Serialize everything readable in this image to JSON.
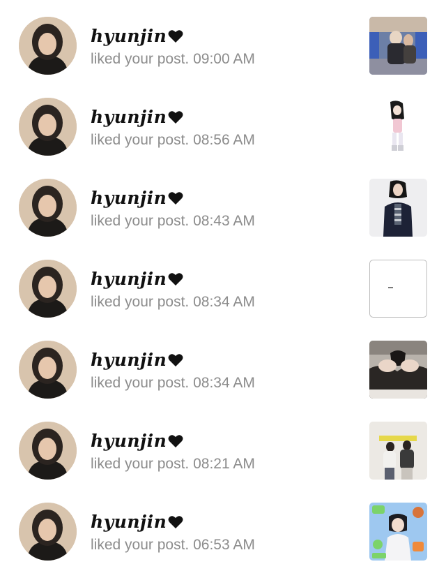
{
  "notifications": [
    {
      "username": "hyunjin",
      "action": "liked your post.",
      "time": "09:00 AM",
      "post_thumbnail": "stage-performance-photo"
    },
    {
      "username": "hyunjin",
      "action": "liked your post.",
      "time": "08:56 AM",
      "post_thumbnail": "anime-character-drawing"
    },
    {
      "username": "hyunjin",
      "action": "liked your post.",
      "time": "08:43 AM",
      "post_thumbnail": "person-in-blazer-photo"
    },
    {
      "username": "hyunjin",
      "action": "liked your post.",
      "time": "08:34 AM",
      "post_thumbnail": "blank-white-image"
    },
    {
      "username": "hyunjin",
      "action": "liked your post.",
      "time": "08:34 AM",
      "post_thumbnail": "hands-heart-photo"
    },
    {
      "username": "hyunjin",
      "action": "liked your post.",
      "time": "08:21 AM",
      "post_thumbnail": "two-people-dancing-photo"
    },
    {
      "username": "hyunjin",
      "action": "liked your post.",
      "time": "06:53 AM",
      "post_thumbnail": "colorful-collage-photo"
    }
  ],
  "colors": {
    "name": "#111111",
    "secondary_text": "#8c8c8c",
    "background": "#ffffff"
  },
  "icons": {
    "heart": "heart-icon"
  }
}
